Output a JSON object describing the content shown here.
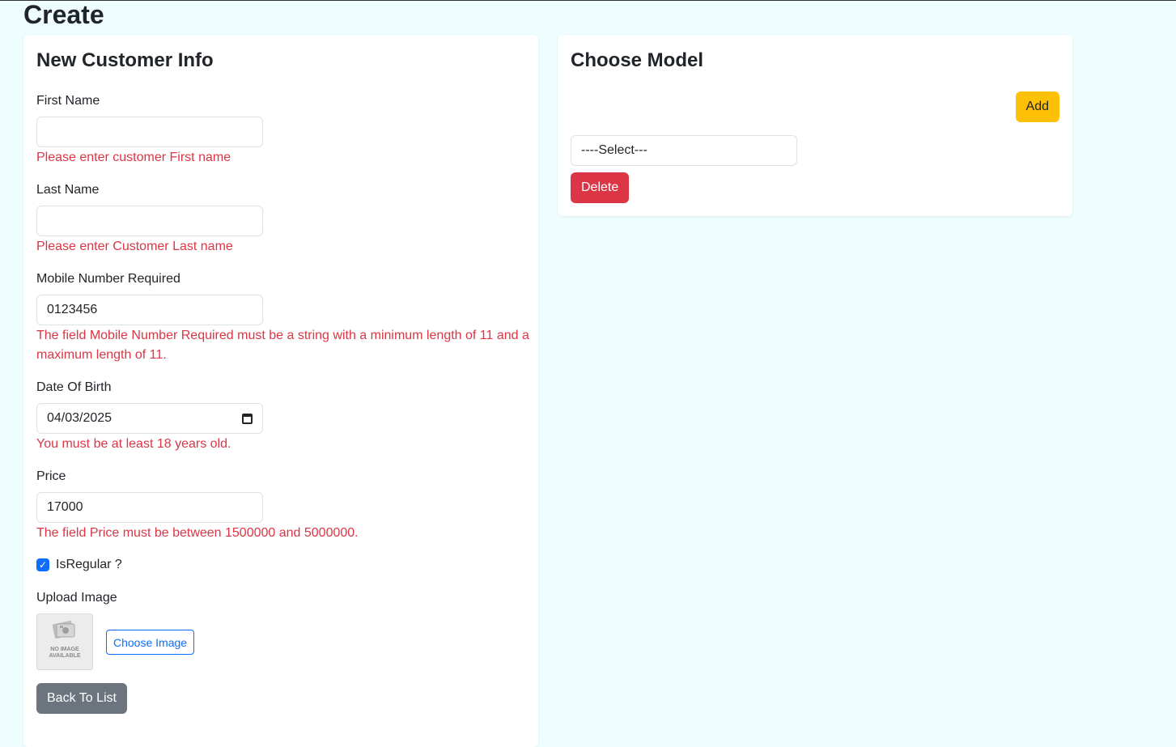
{
  "page": {
    "title": "Create"
  },
  "customer_form": {
    "title": "New Customer Info",
    "first_name": {
      "label": "First Name",
      "value": "",
      "error": "Please enter customer First name"
    },
    "last_name": {
      "label": "Last Name",
      "value": "",
      "error": "Please enter Customer Last name"
    },
    "mobile": {
      "label": "Mobile Number Required",
      "value": "0123456",
      "error": "The field Mobile Number Required must be a string with a minimum length of 11 and a maximum length of 11."
    },
    "dob": {
      "label": "Date Of Birth",
      "value": "04/03/2025",
      "icon": "calendar-icon",
      "error": "You must be at least 18 years old."
    },
    "price": {
      "label": "Price",
      "value": "17000",
      "error": "The field Price must be between 1500000 and 5000000."
    },
    "is_regular": {
      "label": "IsRegular ?",
      "checked": true
    },
    "upload": {
      "label": "Upload Image",
      "placeholder_text": "NO IMAGE\nAVAILABLE",
      "choose_label": "Choose Image"
    },
    "back_label": "Back To List"
  },
  "model_panel": {
    "title": "Choose Model",
    "add_label": "Add",
    "select_value": "----Select---",
    "delete_label": "Delete"
  },
  "colors": {
    "background": "#eefefe",
    "error": "#dc3545",
    "primary": "#0d6efd",
    "warning": "#ffc107",
    "secondary": "#6c757d"
  }
}
